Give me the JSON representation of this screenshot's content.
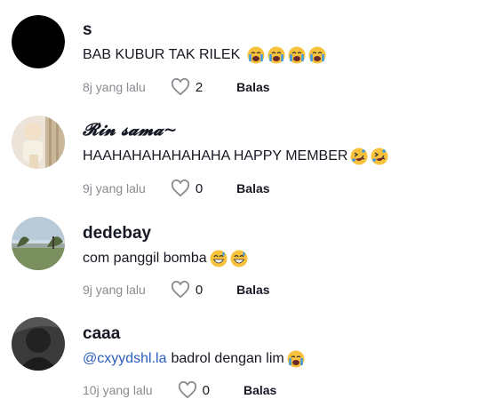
{
  "comments": [
    {
      "username": "s",
      "text": "BAB KUBUR TAK RILEK",
      "mention": "",
      "emojis": [
        "loudly-crying-face-emoji",
        "loudly-crying-face-emoji",
        "loudly-crying-face-emoji",
        "loudly-crying-face-emoji"
      ],
      "time": "8j yang lalu",
      "likes": "2",
      "reply": "Balas"
    },
    {
      "username": "𝓡𝓲𝓷 𝓼𝓪𝓶𝓪~",
      "text": "HAAHAHAHAHAHAHA HAPPY MEMBER",
      "mention": "",
      "emojis": [
        "rolling-on-floor-laughing-emoji",
        "rolling-on-floor-laughing-emoji"
      ],
      "time": "9j yang lalu",
      "likes": "0",
      "reply": "Balas"
    },
    {
      "username": "dedebay",
      "text": "com panggil bomba",
      "mention": "",
      "emojis": [
        "grinning-sweat-emoji",
        "grinning-sweat-emoji"
      ],
      "time": "9j yang lalu",
      "likes": "0",
      "reply": "Balas"
    },
    {
      "username": "caaa",
      "text": "badrol dengan lim",
      "mention": "@cxyydshl.la",
      "emojis": [
        "loudly-crying-face-emoji"
      ],
      "time": "10j yang lalu",
      "likes": "0",
      "reply": "Balas"
    }
  ],
  "colors": {
    "mention": "#2b5db9",
    "meta": "#8a8b91",
    "text": "#161823"
  }
}
